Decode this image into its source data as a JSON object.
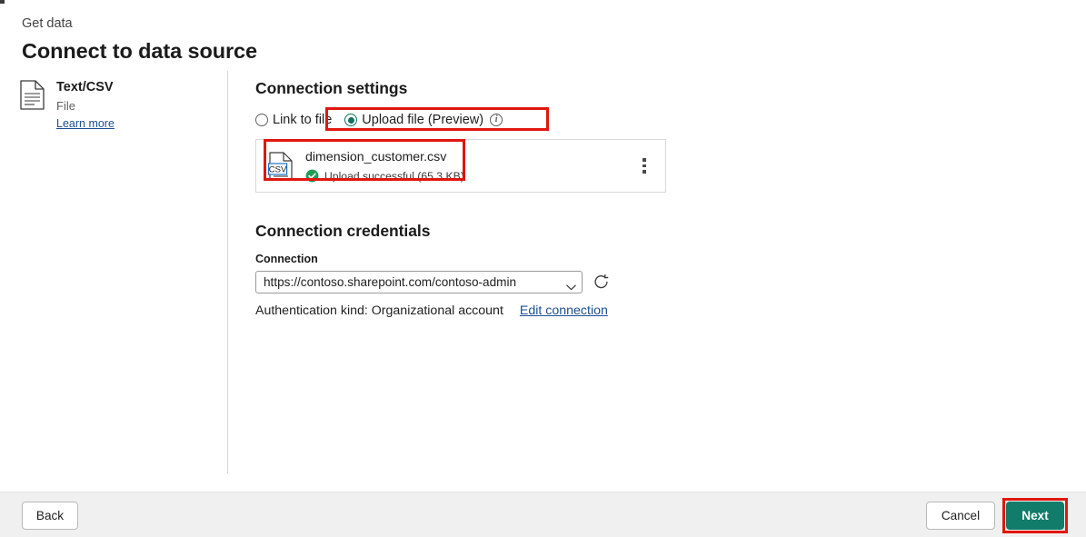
{
  "header": {
    "eyebrow": "Get data",
    "title": "Connect to data source"
  },
  "source": {
    "icon": "text-file-icon",
    "name": "Text/CSV",
    "kind": "File",
    "learn_more": "Learn more"
  },
  "connection_settings": {
    "title": "Connection settings",
    "options": [
      {
        "label": "Link to file",
        "selected": false
      },
      {
        "label": "Upload file (Preview)",
        "selected": true
      }
    ],
    "info_icon": "info-icon",
    "file": {
      "icon": "csv-file-icon",
      "name": "dimension_customer.csv",
      "status_icon": "success-check-icon",
      "status": "Upload successful (65.3 KB)",
      "overflow_icon": "more-vertical-icon"
    }
  },
  "connection_credentials": {
    "title": "Connection credentials",
    "field_label": "Connection",
    "connection_value": "https://contoso.sharepoint.com/contoso-admin",
    "dropdown_icon": "chevron-down-icon",
    "refresh_icon": "refresh-icon",
    "auth_text": "Authentication kind: Organizational account",
    "edit_link": "Edit connection"
  },
  "footer": {
    "back": "Back",
    "cancel": "Cancel",
    "next": "Next"
  },
  "colors": {
    "accent": "#107c69",
    "highlight": "#e0160f",
    "link": "#1d4f91",
    "success": "#1f9d55",
    "footer_bg": "#f0f0f0"
  }
}
